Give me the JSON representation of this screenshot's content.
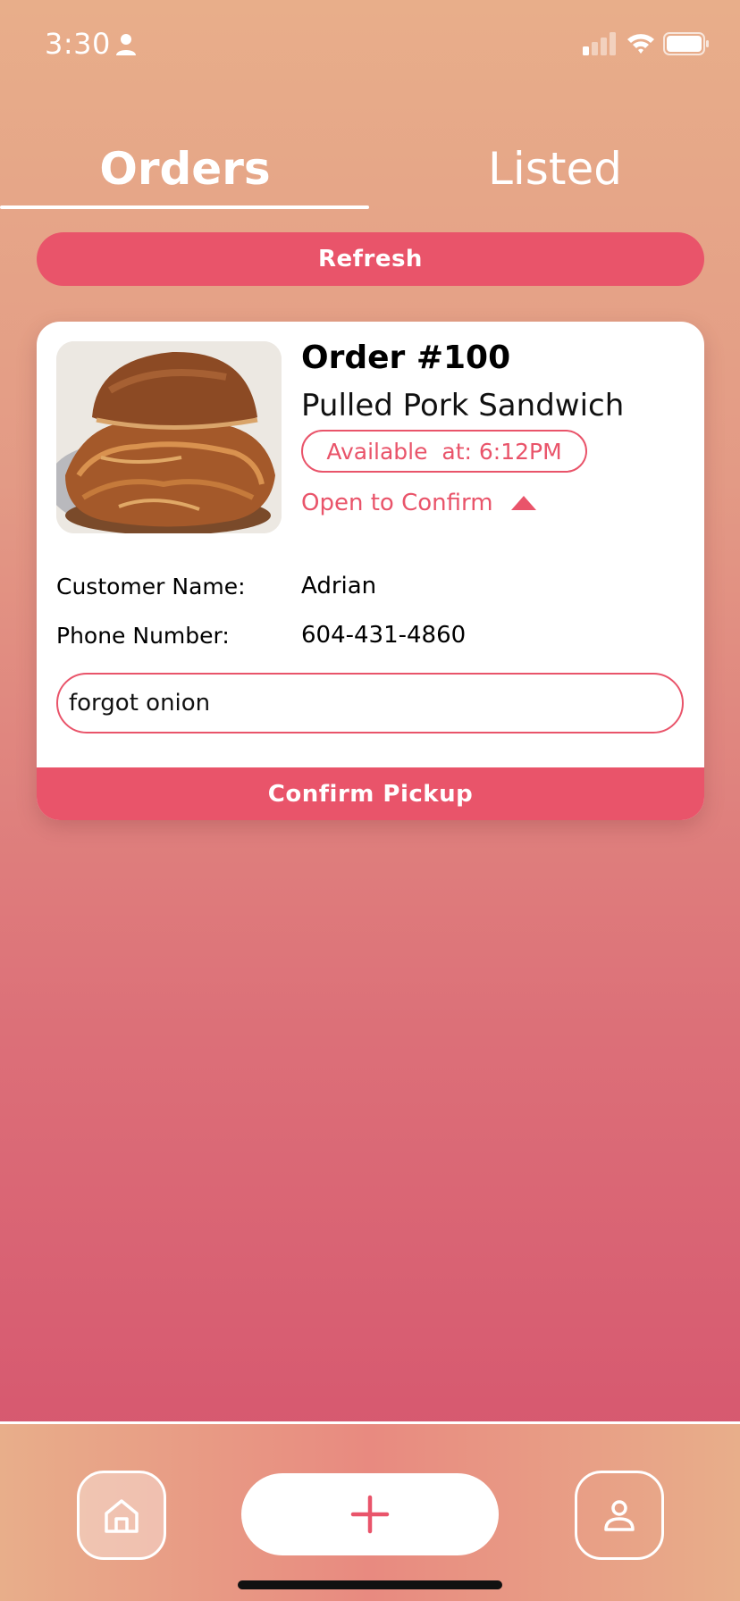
{
  "status_bar": {
    "time": "3:30",
    "icons": [
      "person-icon",
      "cellular-signal-icon",
      "wifi-icon",
      "battery-icon"
    ]
  },
  "tabs": [
    {
      "label": "Orders",
      "active": true
    },
    {
      "label": "Listed",
      "active": false
    }
  ],
  "refresh_label": "Refresh",
  "order": {
    "title": "Order #100",
    "item_name": "Pulled Pork Sandwich",
    "availability": "Available  at: 6:12PM",
    "confirm_toggle": "Open to Confirm",
    "customer_label": "Customer Name:",
    "customer_name": "Adrian",
    "phone_label": "Phone Number:",
    "phone_number": "604-431-4860",
    "note_value": "forgot onion",
    "confirm_pickup_label": "Confirm Pickup",
    "image_icon": "pulled-pork-sandwich-photo"
  },
  "bottom_nav": {
    "home_icon": "home-icon",
    "add_icon": "plus-icon",
    "profile_icon": "profile-icon"
  },
  "colors": {
    "accent": "#e9546a",
    "background_top": "#e8ae8a",
    "background_bottom": "#d44f6c"
  }
}
